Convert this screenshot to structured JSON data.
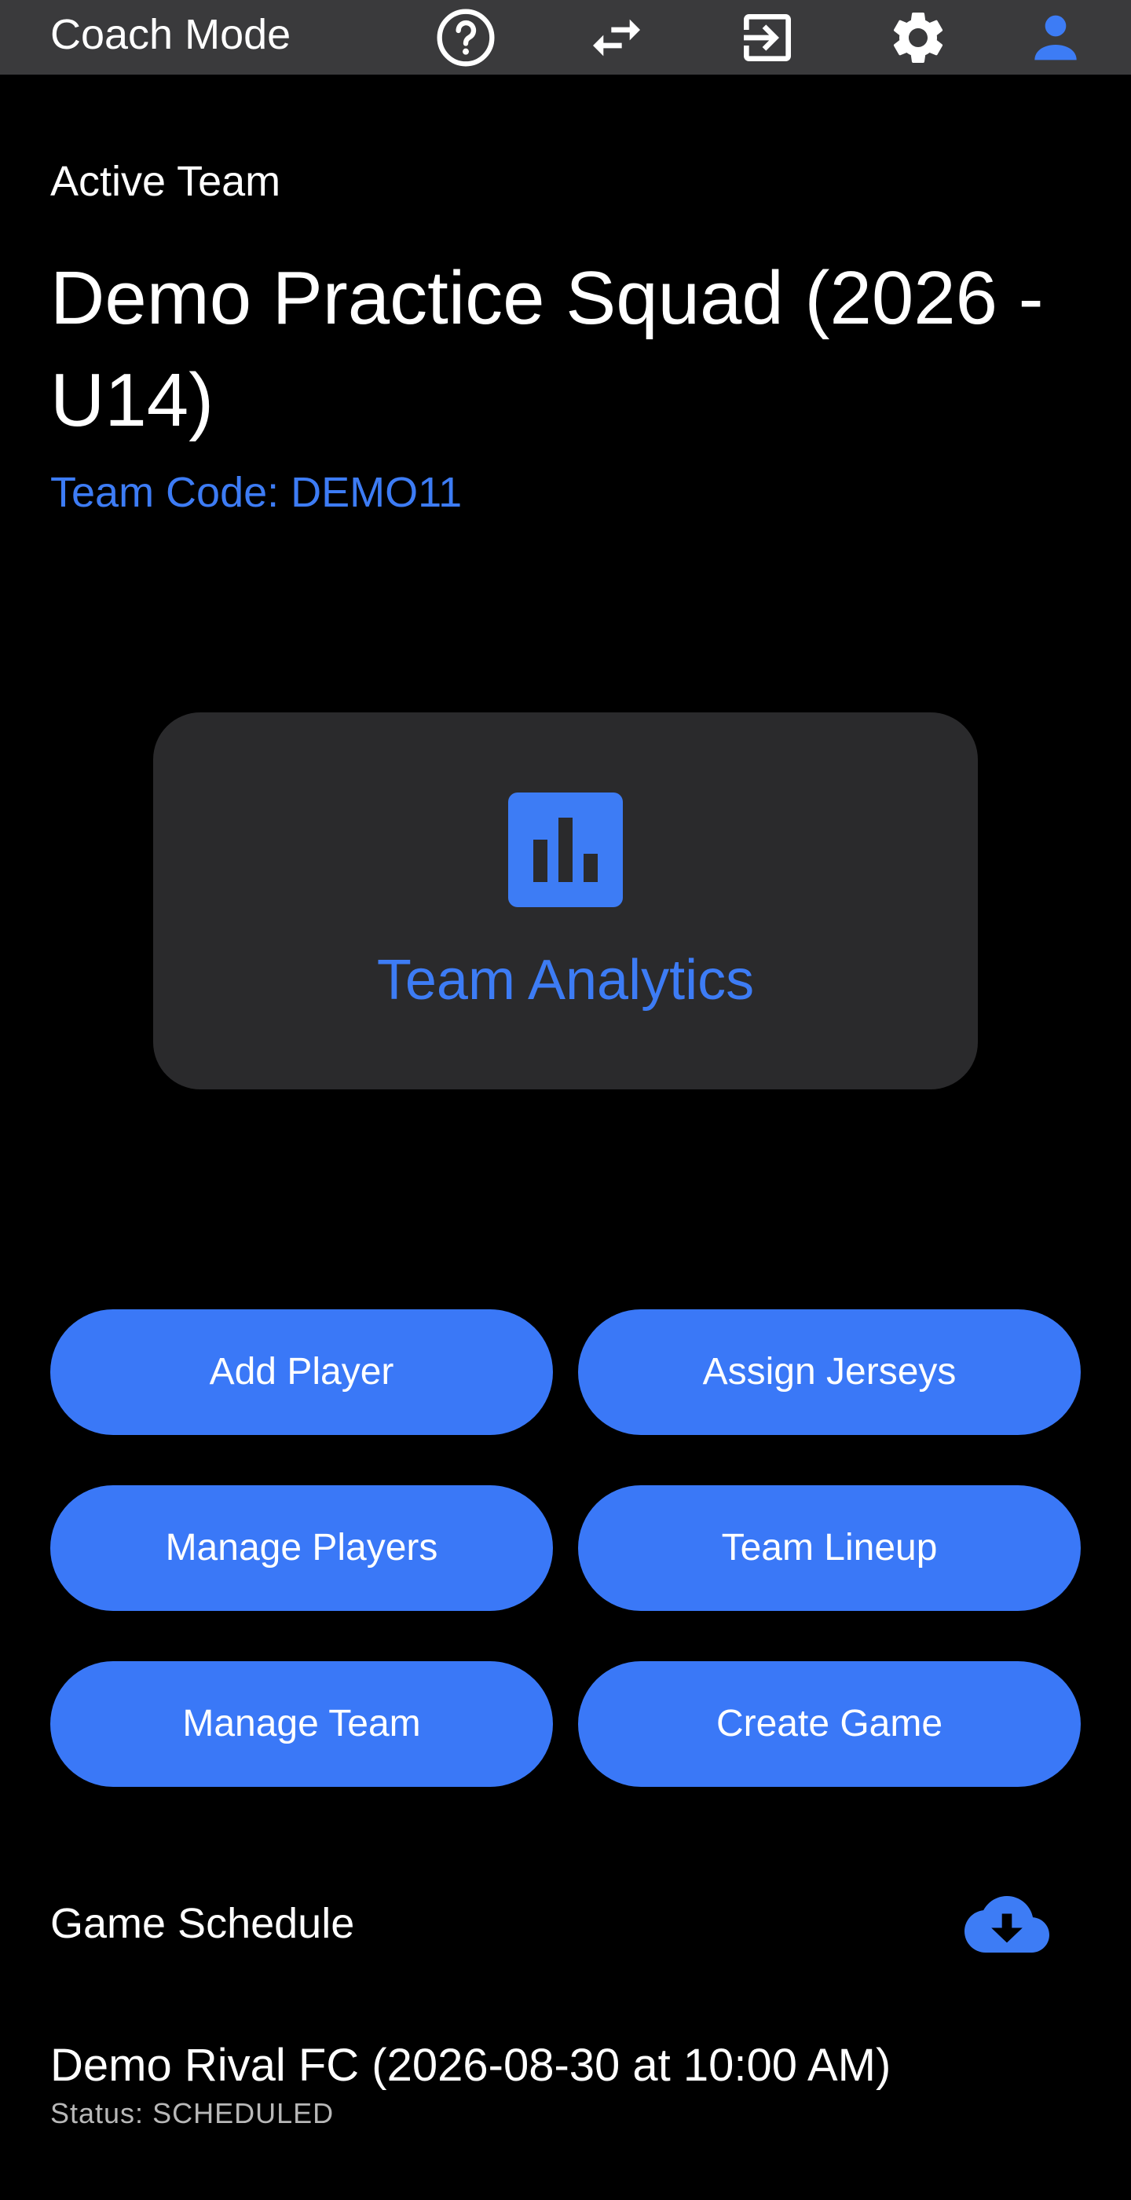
{
  "app": {
    "title": "Coach Mode",
    "accent_color": "#3d7cf5",
    "toolbar_icons": [
      "help-circle-icon",
      "swap-icon",
      "exit-icon",
      "settings-gear-icon",
      "account-icon"
    ]
  },
  "team": {
    "section_label": "Active Team",
    "name": "Demo Practice Squad (2026 - U14)",
    "code_label": "Team Code: DEMO11"
  },
  "analytics": {
    "label": "Team Analytics",
    "icon": "bar-chart-icon"
  },
  "actions": {
    "add_player": "Add Player",
    "assign_jerseys": "Assign Jerseys",
    "manage_players": "Manage Players",
    "team_lineup": "Team Lineup",
    "manage_team": "Manage Team",
    "create_game": "Create Game"
  },
  "schedule": {
    "title": "Game Schedule",
    "download_icon": "cloud-download-icon",
    "games": [
      {
        "title": "Demo Rival FC (2026-08-30 at 10:00 AM)",
        "status": "Status: SCHEDULED"
      }
    ]
  }
}
